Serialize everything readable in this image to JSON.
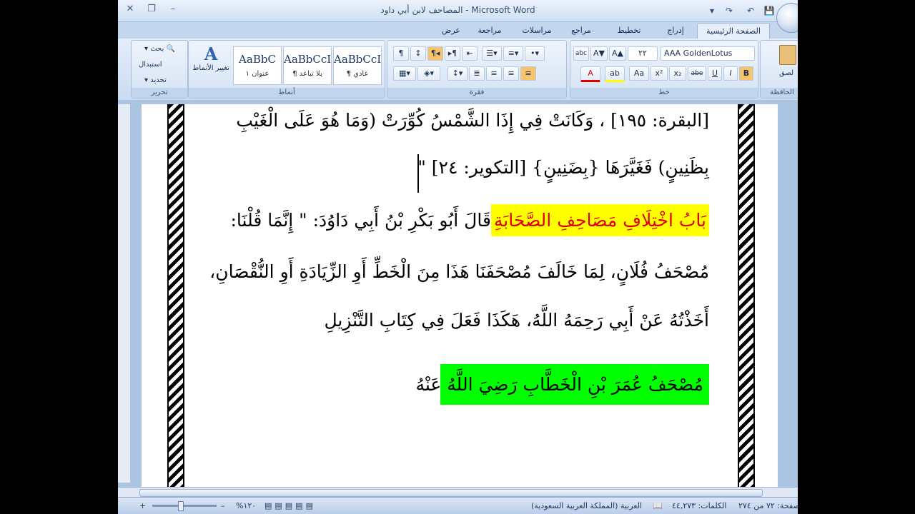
{
  "window": {
    "title": "المصاحف لابن أبي داود - Microsoft Word",
    "controls": {
      "close": "✕",
      "restore": "❐",
      "minimize": "–"
    }
  },
  "quick_access": {
    "save": "💾",
    "undo": "↶",
    "redo": "↷",
    "dropdown": "▾"
  },
  "tabs": [
    {
      "label": "الصفحة الرئيسية",
      "active": true
    },
    {
      "label": "إدراج"
    },
    {
      "label": "تخطيط الصفحة"
    },
    {
      "label": "مراجع"
    },
    {
      "label": "مراسلات"
    },
    {
      "label": "مراجعة"
    },
    {
      "label": "عرض"
    }
  ],
  "ribbon": {
    "clipboard": {
      "label": "الحافظة",
      "paste": "لصق"
    },
    "font": {
      "label": "خط",
      "font_name": "AAA GoldenLotus",
      "font_size": "٢٢",
      "bold": "B",
      "italic": "I",
      "underline": "U",
      "strike": "abe",
      "subscript": "x₂",
      "superscript": "x²",
      "change_case": "Aa",
      "grow": "A▲",
      "shrink": "A▼",
      "clear": "abc",
      "highlight": "ab",
      "font_color": "A"
    },
    "paragraph": {
      "label": "فقرة"
    },
    "styles": {
      "label": "أنماط",
      "items": [
        {
          "sample": "AaBbCcI",
          "name": "¶ عادي"
        },
        {
          "sample": "AaBbCcI",
          "name": "¶ بلا تباعد"
        },
        {
          "sample": "AaBbC",
          "name": "عنوان ١"
        }
      ],
      "change_styles": "تغيير الأنماط"
    },
    "editing": {
      "label": "تحرير",
      "find": "بحث",
      "replace": "استبدال",
      "select": "تحديد"
    }
  },
  "document": {
    "lines": [
      {
        "text": "[البقرة: ١٩٥] ، وَكَانَتْ فِي إِذَا الشَّمْسُ كُوِّرَتْ (وَمَا هُوَ عَلَى الْغَيْبِ"
      },
      {
        "text": "بِظَنِينٍ) فَغَيَّرَهَا {بِضَنِينٍ} [التكوير: ٢٤] \""
      },
      {
        "text_plain": "قَالَ أَبُو بَكْرِ بْنُ أَبِي دَاوُدَ: \" إِنَّمَا قُلْنَا:",
        "text_highlight": "بَابُ اخْتِلَافِ مَصَاحِفِ الصَّحَابَةِ"
      },
      {
        "text": "مُصْحَفُ فُلَانٍ، لِمَا خَالَفَ مُصْحَفَنَا هَذَا مِنَ الْخَطِّ أَوِ الزِّيَادَةِ أَوِ النُّقْصَانِ،"
      },
      {
        "text": "أَخَذْتُهُ عَنْ أَبِي رَحِمَهُ اللَّهُ، هَكَذَا فَعَلَ فِي كِتَابِ التَّنْزِيلِ"
      },
      {
        "text_highlight": "مُصْحَفُ عُمَرَ بْنِ الْخَطَّابِ رَضِيَ اللَّهُ عَنْهُ"
      }
    ]
  },
  "status_bar": {
    "page": "صفحة: ٧٢ من ٢٧٤",
    "words": "الكلمات: ٤٤,٢٧٣",
    "language": "العربية (المملكة العربية السعودية)",
    "zoom": "%١٢٠",
    "zoom_out": "–",
    "zoom_in": "+"
  },
  "colors": {
    "highlight_yellow": "#ffff00",
    "highlight_green": "#00ff00",
    "heading_red": "#e00000",
    "ribbon_bg": "#dbe6f5"
  }
}
